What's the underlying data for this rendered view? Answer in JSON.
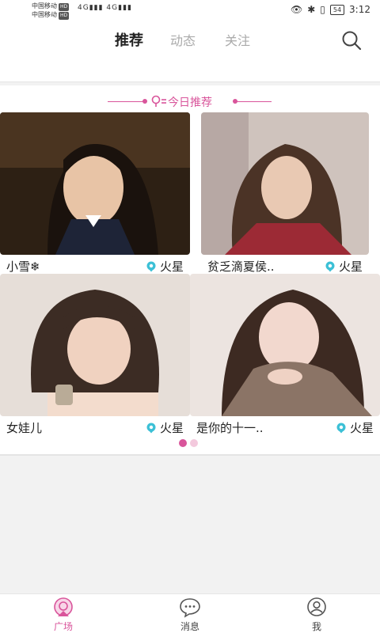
{
  "status_bar": {
    "carrier_1": "中国移动",
    "carrier_2": "中国移动",
    "hd_badge": "HD",
    "network_1": "4G",
    "network_2": "4G",
    "battery": "54",
    "time": "3:12"
  },
  "header": {
    "tabs": [
      {
        "label": "推荐",
        "active": true
      },
      {
        "label": "动态",
        "active": false
      },
      {
        "label": "关注",
        "active": false
      }
    ],
    "search_icon": "search-icon"
  },
  "section": {
    "title": "今日推荐",
    "accent_color": "#d9559b"
  },
  "cards": [
    {
      "name": "小雪❄",
      "location": "火星",
      "photo": "photo-portrait-1"
    },
    {
      "name": "贫乏滴夏侯..",
      "location": "火星",
      "photo": "photo-portrait-2"
    },
    {
      "name": "女娃儿",
      "location": "火星",
      "photo": "photo-portrait-3"
    },
    {
      "name": "是你的十一..",
      "location": "火星",
      "photo": "photo-portrait-4"
    }
  ],
  "pager": {
    "pages": 2,
    "current": 1
  },
  "bottom_nav": [
    {
      "label": "广场",
      "icon": "plaza-icon",
      "active": true
    },
    {
      "label": "消息",
      "icon": "message-icon",
      "active": false
    },
    {
      "label": "我",
      "icon": "profile-icon",
      "active": false
    }
  ]
}
